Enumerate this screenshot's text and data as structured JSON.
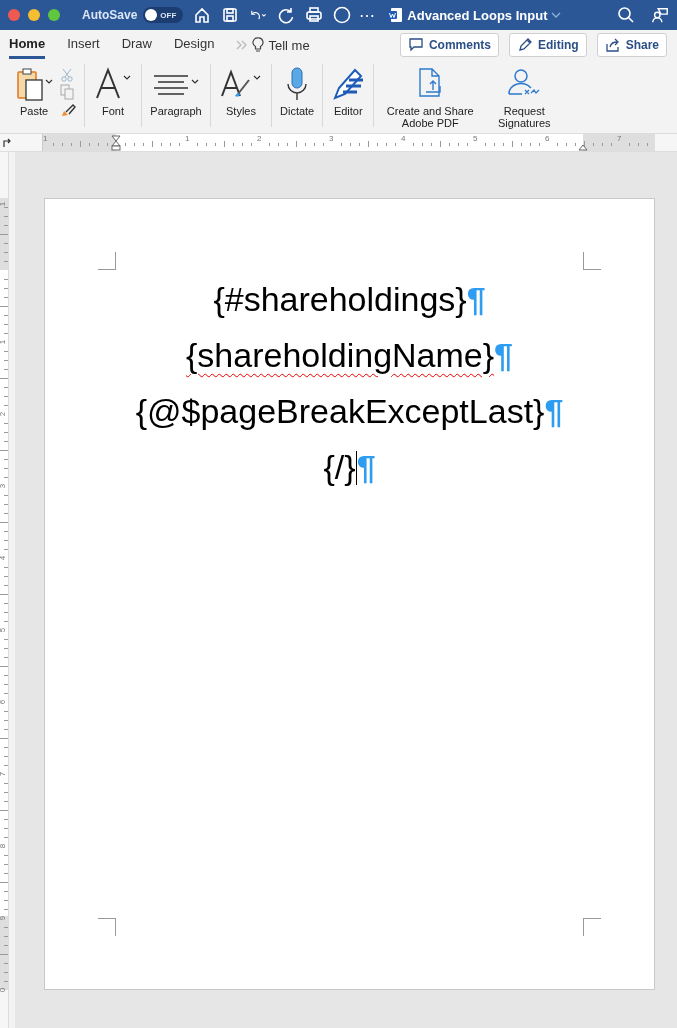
{
  "window": {
    "title": "Advanced Loops Input",
    "autosave": {
      "label": "AutoSave",
      "on": false,
      "state_text": "OFF"
    },
    "more": "⋯"
  },
  "tabs": [
    {
      "label": "Home",
      "selected": true
    },
    {
      "label": "Insert",
      "selected": false
    },
    {
      "label": "Draw",
      "selected": false
    },
    {
      "label": "Design",
      "selected": false
    }
  ],
  "tell_me": "Tell me",
  "actions": [
    {
      "label": "Comments",
      "kind": "comments"
    },
    {
      "label": "Editing",
      "kind": "editing"
    },
    {
      "label": "Share",
      "kind": "share"
    }
  ],
  "ribbon": [
    {
      "label": "Paste",
      "kind": "paste"
    },
    {
      "label": "Font",
      "kind": "font"
    },
    {
      "label": "Paragraph",
      "kind": "paragraph"
    },
    {
      "label": "Styles",
      "kind": "styles"
    },
    {
      "label": "Dictate",
      "kind": "dictate"
    },
    {
      "label": "Editor",
      "kind": "editor"
    },
    {
      "label": "Create and Share Adobe PDF",
      "kind": "pdf"
    },
    {
      "label": "Request Signatures",
      "kind": "signatures"
    }
  ],
  "ruler": {
    "labels": [
      "1",
      "1",
      "2",
      "3",
      "4",
      "5",
      "6",
      "7"
    ]
  },
  "vertical_ruler": {
    "labels": [
      "1",
      "1",
      "2",
      "3",
      "4",
      "5",
      "6",
      "7",
      "8",
      "9",
      "0"
    ]
  },
  "document": {
    "paragraphs": [
      {
        "text": "{#shareholdings}",
        "mark": "¶",
        "misspelled": false,
        "cursor": false
      },
      {
        "text": "{shareholdingName}",
        "mark": "¶",
        "misspelled": true,
        "cursor": false
      },
      {
        "text": "{@$pageBreakExceptLast}",
        "mark": "¶",
        "misspelled": false,
        "cursor": false
      },
      {
        "text": "{/}",
        "mark": "¶",
        "misspelled": false,
        "cursor": true
      }
    ]
  }
}
